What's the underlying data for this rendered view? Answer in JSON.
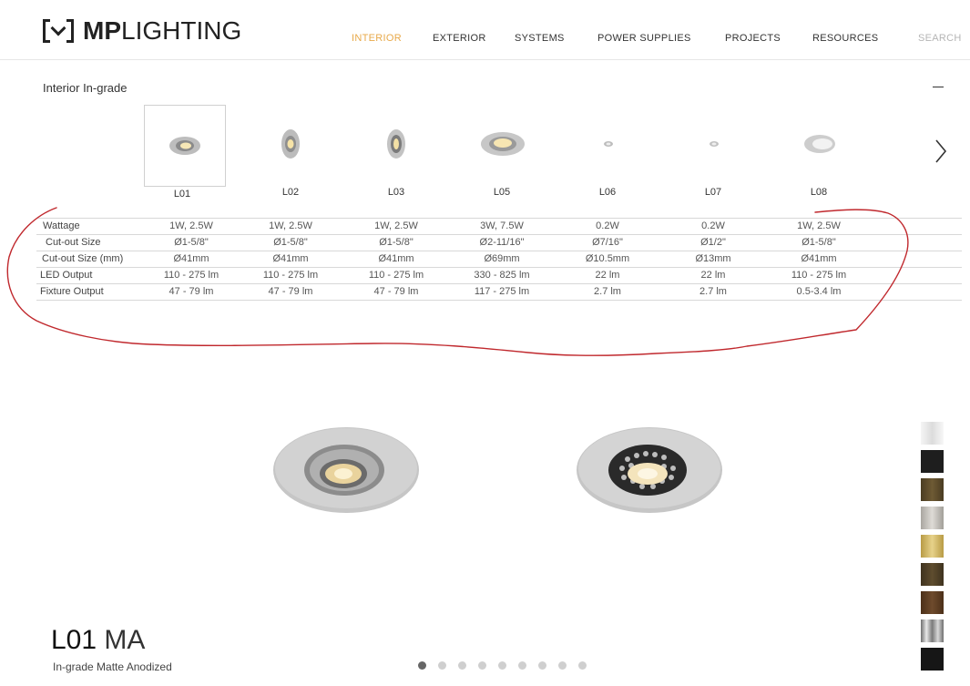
{
  "brand": {
    "mark": "[v]",
    "name_bold": "MP",
    "name_light": "LIGHTING"
  },
  "nav": {
    "items": [
      "INTERIOR",
      "EXTERIOR",
      "SYSTEMS",
      "POWER SUPPLIES",
      "PROJECTS",
      "RESOURCES"
    ],
    "active": "INTERIOR",
    "search_label": "SEARCH"
  },
  "section": {
    "title": "Interior In-grade",
    "collapse_icon": "minus-icon"
  },
  "products": [
    {
      "code": "L01",
      "selected": true
    },
    {
      "code": "L02",
      "selected": false
    },
    {
      "code": "L03",
      "selected": false
    },
    {
      "code": "L05",
      "selected": false
    },
    {
      "code": "L06",
      "selected": false
    },
    {
      "code": "L07",
      "selected": false
    },
    {
      "code": "L08",
      "selected": false
    }
  ],
  "specs": {
    "rows": [
      {
        "label": "Wattage",
        "values": [
          "1W, 2.5W",
          "1W, 2.5W",
          "1W, 2.5W",
          "3W, 7.5W",
          "0.2W",
          "0.2W",
          "1W, 2.5W"
        ]
      },
      {
        "label": "Cut-out Size",
        "values": [
          "Ø1-5/8\"",
          "Ø1-5/8\"",
          "Ø1-5/8\"",
          "Ø2-11/16\"",
          "Ø7/16\"",
          "Ø1/2\"",
          "Ø1-5/8\""
        ]
      },
      {
        "label": "Cut-out Size (mm)",
        "values": [
          "Ø41mm",
          "Ø41mm",
          "Ø41mm",
          "Ø69mm",
          "Ø10.5mm",
          "Ø13mm",
          "Ø41mm"
        ]
      },
      {
        "label": "LED Output",
        "values": [
          "110 - 275 lm",
          "110 - 275 lm",
          "110 - 275 lm",
          "330 - 825 lm",
          "22 lm",
          "22 lm",
          "110 - 275 lm"
        ]
      },
      {
        "label": "Fixture Output",
        "values": [
          "47 - 79 lm",
          "47 - 79 lm",
          "47 - 79 lm",
          "117 - 275 lm",
          "2.7 lm",
          "2.7 lm",
          "0.5-3.4 lm"
        ]
      }
    ]
  },
  "hero": {
    "model": "L01",
    "finish_code": "MA",
    "description": "In-grade Matte Anodized",
    "slide_count": 9,
    "active_slide": 1
  },
  "finishes": [
    {
      "name": "white",
      "color": "#e9e9e9"
    },
    {
      "name": "black",
      "color": "#1e1e1e"
    },
    {
      "name": "bronze",
      "color": "#5a4a2c"
    },
    {
      "name": "satin nickel",
      "color": "#b9b6b0"
    },
    {
      "name": "brass",
      "color": "#cdb35a"
    },
    {
      "name": "dark bronze",
      "color": "#4d3f27"
    },
    {
      "name": "copper",
      "color": "#5b3a22"
    },
    {
      "name": "chrome",
      "color": "#9a9a9a"
    },
    {
      "name": "matte black",
      "color": "#1a1a1a"
    }
  ],
  "colors": {
    "accent": "#e8a94a",
    "annotation": "#c0282d"
  }
}
